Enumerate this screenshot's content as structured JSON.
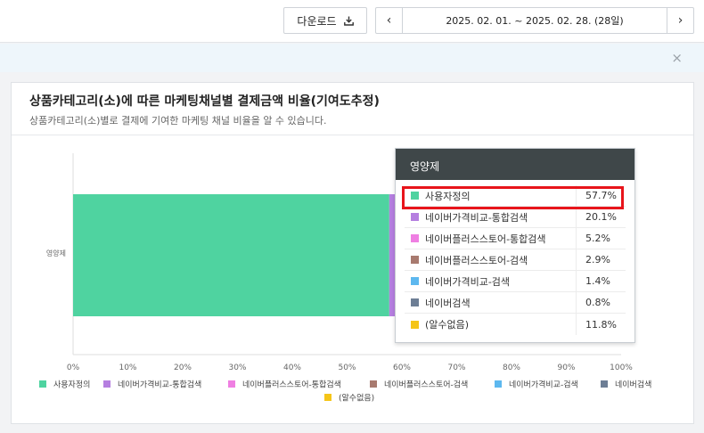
{
  "toolbar": {
    "download_label": "다운로드",
    "date_range": "2025. 02. 01. ~ 2025. 02. 28. (28일)",
    "prev_symbol": "‹",
    "next_symbol": "›"
  },
  "notice": {
    "close_symbol": "×"
  },
  "card": {
    "title": "상품카테고리(소)에 따른 마케팅채널별 결제금액 비율(기여도추정)",
    "subtitle": "상품카테고리(소)별로 결제에 기여한 마케팅 채널 비율을 알 수 있습니다."
  },
  "chart_data": {
    "type": "bar",
    "orientation": "horizontal",
    "stacked": true,
    "categories": [
      "영양제"
    ],
    "series": [
      {
        "name": "사용자정의",
        "values": [
          57.7
        ],
        "color": "#4fd3a0",
        "label": "57.7%"
      },
      {
        "name": "네이버가격비교-통합검색",
        "values": [
          20.1
        ],
        "color": "#b57fe0",
        "label": "20.1%"
      },
      {
        "name": "네이버플러스스토어-통합검색",
        "values": [
          5.2
        ],
        "color": "#ef7fe2",
        "label": "5.2%"
      },
      {
        "name": "네이버플러스스토어-검색",
        "values": [
          2.9
        ],
        "color": "#a87a6f",
        "label": "2.9%"
      },
      {
        "name": "네이버가격비교-검색",
        "values": [
          1.4
        ],
        "color": "#5db8ef",
        "label": "1.4%"
      },
      {
        "name": "네이버검색",
        "values": [
          0.8
        ],
        "color": "#6d7e95",
        "label": "0.8%"
      },
      {
        "name": "(알수없음)",
        "values": [
          11.8
        ],
        "color": "#f5c518",
        "label": "11.8%"
      }
    ],
    "xlim": [
      0,
      100
    ],
    "xticks": [
      "0%",
      "10%",
      "20%",
      "30%",
      "40%",
      "50%",
      "60%",
      "70%",
      "80%",
      "90%",
      "100%"
    ],
    "legend_position": "bottom",
    "tooltip": {
      "title": "영양제",
      "highlighted": "사용자정의"
    }
  }
}
